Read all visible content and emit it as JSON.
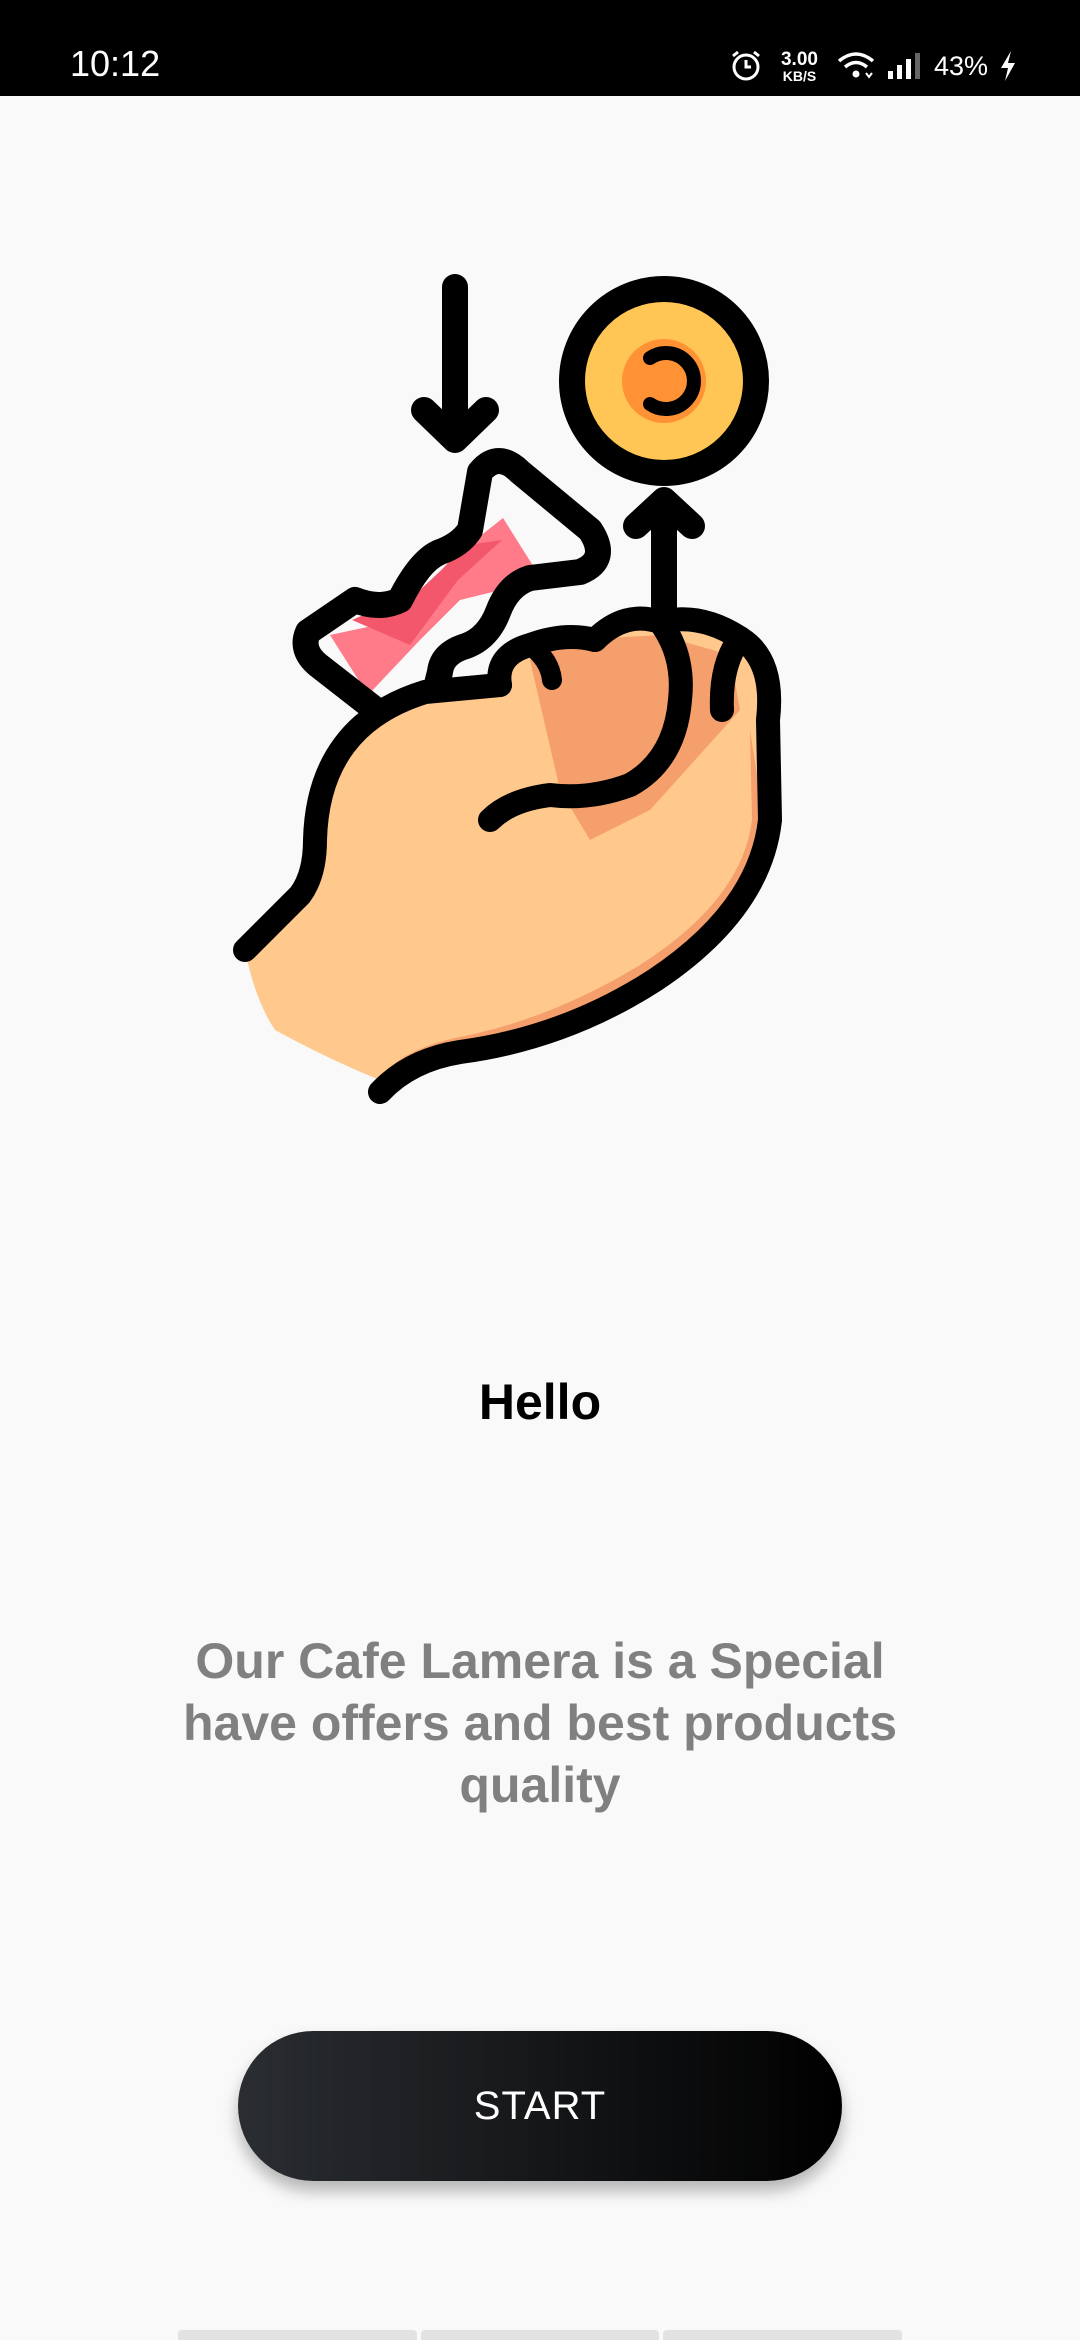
{
  "status_bar": {
    "time": "10:12",
    "net_speed_value": "3.00",
    "net_speed_unit": "KB/S",
    "battery_percent": "43%",
    "icons": [
      "alarm-icon",
      "wifi-icon",
      "signal-icon",
      "charging-icon"
    ]
  },
  "onboarding": {
    "illustration": "hand-candy-coin-illustration",
    "title": "Hello",
    "description": "Our Cafe Lamera is a Special have offers and best products quality",
    "start_label": "START"
  },
  "colors": {
    "background": "#f9f9f9",
    "button": "#000000",
    "title": "#000000",
    "description": "#808080",
    "candy": "#f2576c",
    "coin": "#ffc655",
    "skin": "#ffc88c"
  }
}
